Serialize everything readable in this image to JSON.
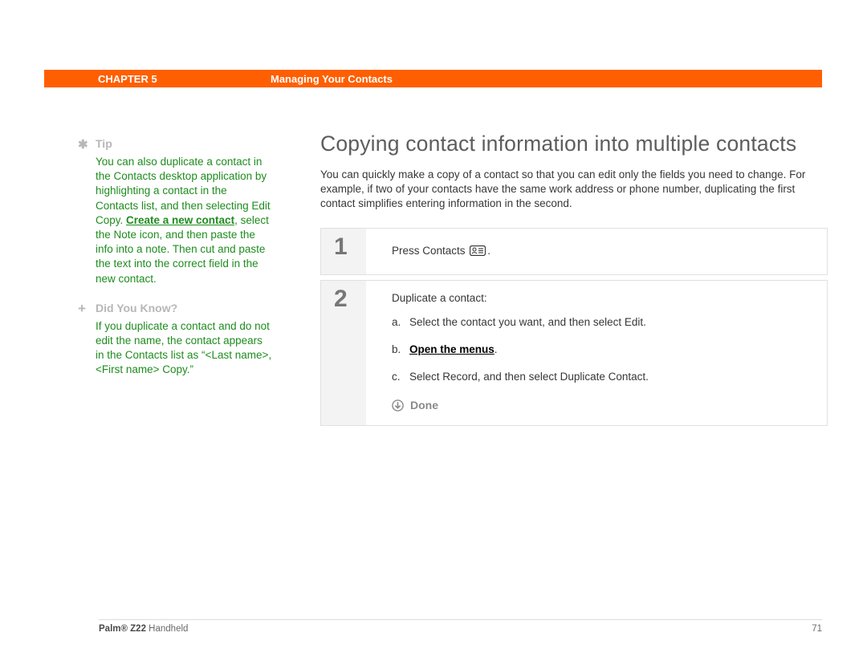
{
  "header": {
    "chapter": "CHAPTER 5",
    "title": "Managing Your Contacts"
  },
  "main": {
    "title": "Copying contact information into multiple contacts",
    "intro": "You can quickly make a copy of a contact so that you can edit only the fields you need to change. For example, if two of your contacts have the same work address or phone number, duplicating the first contact simplifies entering information in the second."
  },
  "sidebar": {
    "tip": {
      "heading": "Tip",
      "body_before_link": "You can also duplicate a contact in the Contacts desktop application by highlighting a contact in the Contacts list, and then selecting Edit Copy. ",
      "link_text": "Create a new contact",
      "body_after_link": ", select the Note icon, and then paste the info into a note. Then cut and paste the text into the correct field in the new contact."
    },
    "dyk": {
      "heading": "Did You Know?",
      "body": "If you duplicate a contact and do not edit the name, the contact appears in the Contacts list as “<Last name>, <First name> Copy.”"
    }
  },
  "steps": {
    "s1": {
      "num": "1",
      "before_icon": "Press Contacts ",
      "after_icon": "."
    },
    "s2": {
      "num": "2",
      "intro": "Duplicate a contact:",
      "a_label": "a.",
      "a_text": "Select the contact you want, and then select Edit.",
      "b_label": "b.",
      "b_link": "Open the menus",
      "b_after": ".",
      "c_label": "c.",
      "c_text": "Select Record, and then select Duplicate Contact.",
      "done": "Done"
    }
  },
  "footer": {
    "product_bold": "Palm® Z22",
    "product_rest": " Handheld",
    "page": "71"
  }
}
